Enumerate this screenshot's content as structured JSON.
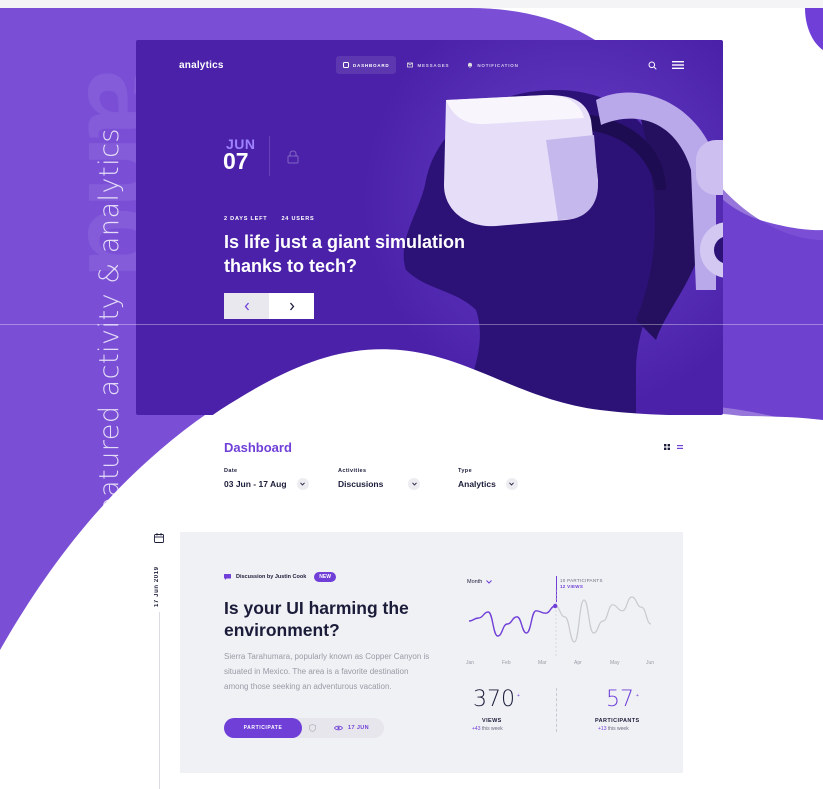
{
  "app": {
    "logo": "analytics"
  },
  "nav": [
    {
      "label": "DASHBOARD",
      "active": true,
      "icon": "dashboard-icon"
    },
    {
      "label": "MESSAGES",
      "active": false,
      "icon": "mail-icon"
    },
    {
      "label": "NOTIFICATION",
      "active": false,
      "icon": "bell-icon"
    }
  ],
  "side": {
    "big_word": "and",
    "title": "featured activity & analytics"
  },
  "featured": {
    "month": "JUN",
    "day": "07",
    "days_left": "2 DAYS LEFT",
    "users": "24 USERS",
    "title": "Is life just a giant simulation thanks to tech?"
  },
  "dashboard": {
    "title": "Dashboard",
    "filters": [
      {
        "label": "Date",
        "value": "03 Jun - 17 Aug"
      },
      {
        "label": "Activities",
        "value": "Discusions"
      },
      {
        "label": "Type",
        "value": "Analytics"
      }
    ]
  },
  "timeline": {
    "date": "17 Jun 2019"
  },
  "card": {
    "discussion_by": "Discussion by Justin Cook",
    "badge": "NEW",
    "title": "Is your UI harming the environment?",
    "description": "Sierra Tarahumara, popularly known as Copper Canyon is situated in Mexico. The area is a favorite destination among those seeking an adventurous vacation.",
    "participate_label": "PARTICIPATE",
    "views_date": "17 JUN",
    "month_selector": "Month",
    "tooltip": {
      "participants": "10 PARTICIPANTS",
      "views": "12 VIEWS"
    },
    "stats": [
      {
        "value": "370",
        "label": "VIEWS",
        "delta": "+43",
        "delta_text": "this week"
      },
      {
        "value": "57",
        "label": "PARTICIPANTS",
        "delta": "+13",
        "delta_text": "this week"
      }
    ]
  },
  "chart_data": {
    "type": "line",
    "x": [
      "Jan",
      "Feb",
      "Mar",
      "Apr",
      "May",
      "Jun"
    ],
    "series": [
      {
        "values": [
          0.55,
          0.6,
          0.7,
          0.3,
          0.5,
          0.62,
          0.35,
          0.72,
          0.68,
          0.8,
          0.62,
          0.2,
          0.9,
          0.35,
          0.55,
          0.82,
          0.72,
          0.95,
          0.78,
          0.5
        ]
      }
    ],
    "highlight_index": 9,
    "colors": {
      "active": "#6f3fd8",
      "inactive": "#c9c9cf"
    }
  },
  "colors": {
    "accent": "#6f3fd8",
    "hero": "#4a21a8",
    "bg_purple": "#7a4fd6"
  }
}
